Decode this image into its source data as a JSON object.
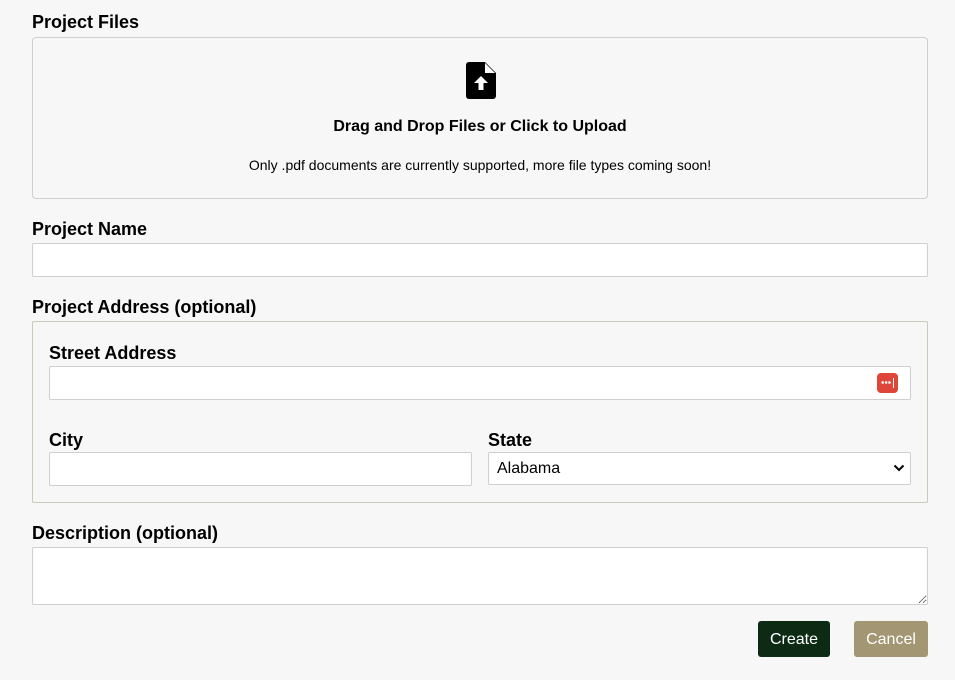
{
  "files": {
    "label": "Project Files",
    "drop_title": "Drag and Drop Files or Click to Upload",
    "drop_hint": "Only .pdf documents are currently supported, more file types coming soon!",
    "icon": "file-upload-icon"
  },
  "project_name": {
    "label": "Project Name",
    "value": ""
  },
  "address": {
    "label": "Project Address (optional)",
    "street": {
      "label": "Street Address",
      "value": "",
      "autofill_icon": "password-manager-icon"
    },
    "city": {
      "label": "City",
      "value": ""
    },
    "state": {
      "label": "State",
      "selected": "Alabama",
      "icon": "chevron-down-icon"
    }
  },
  "description": {
    "label": "Description (optional)",
    "value": ""
  },
  "actions": {
    "create": "Create",
    "cancel": "Cancel"
  },
  "colors": {
    "create_bg": "#0d2b14",
    "cancel_bg": "#a39673",
    "autofill_icon": "#e0453a",
    "page_bg": "#f7f7f7"
  }
}
